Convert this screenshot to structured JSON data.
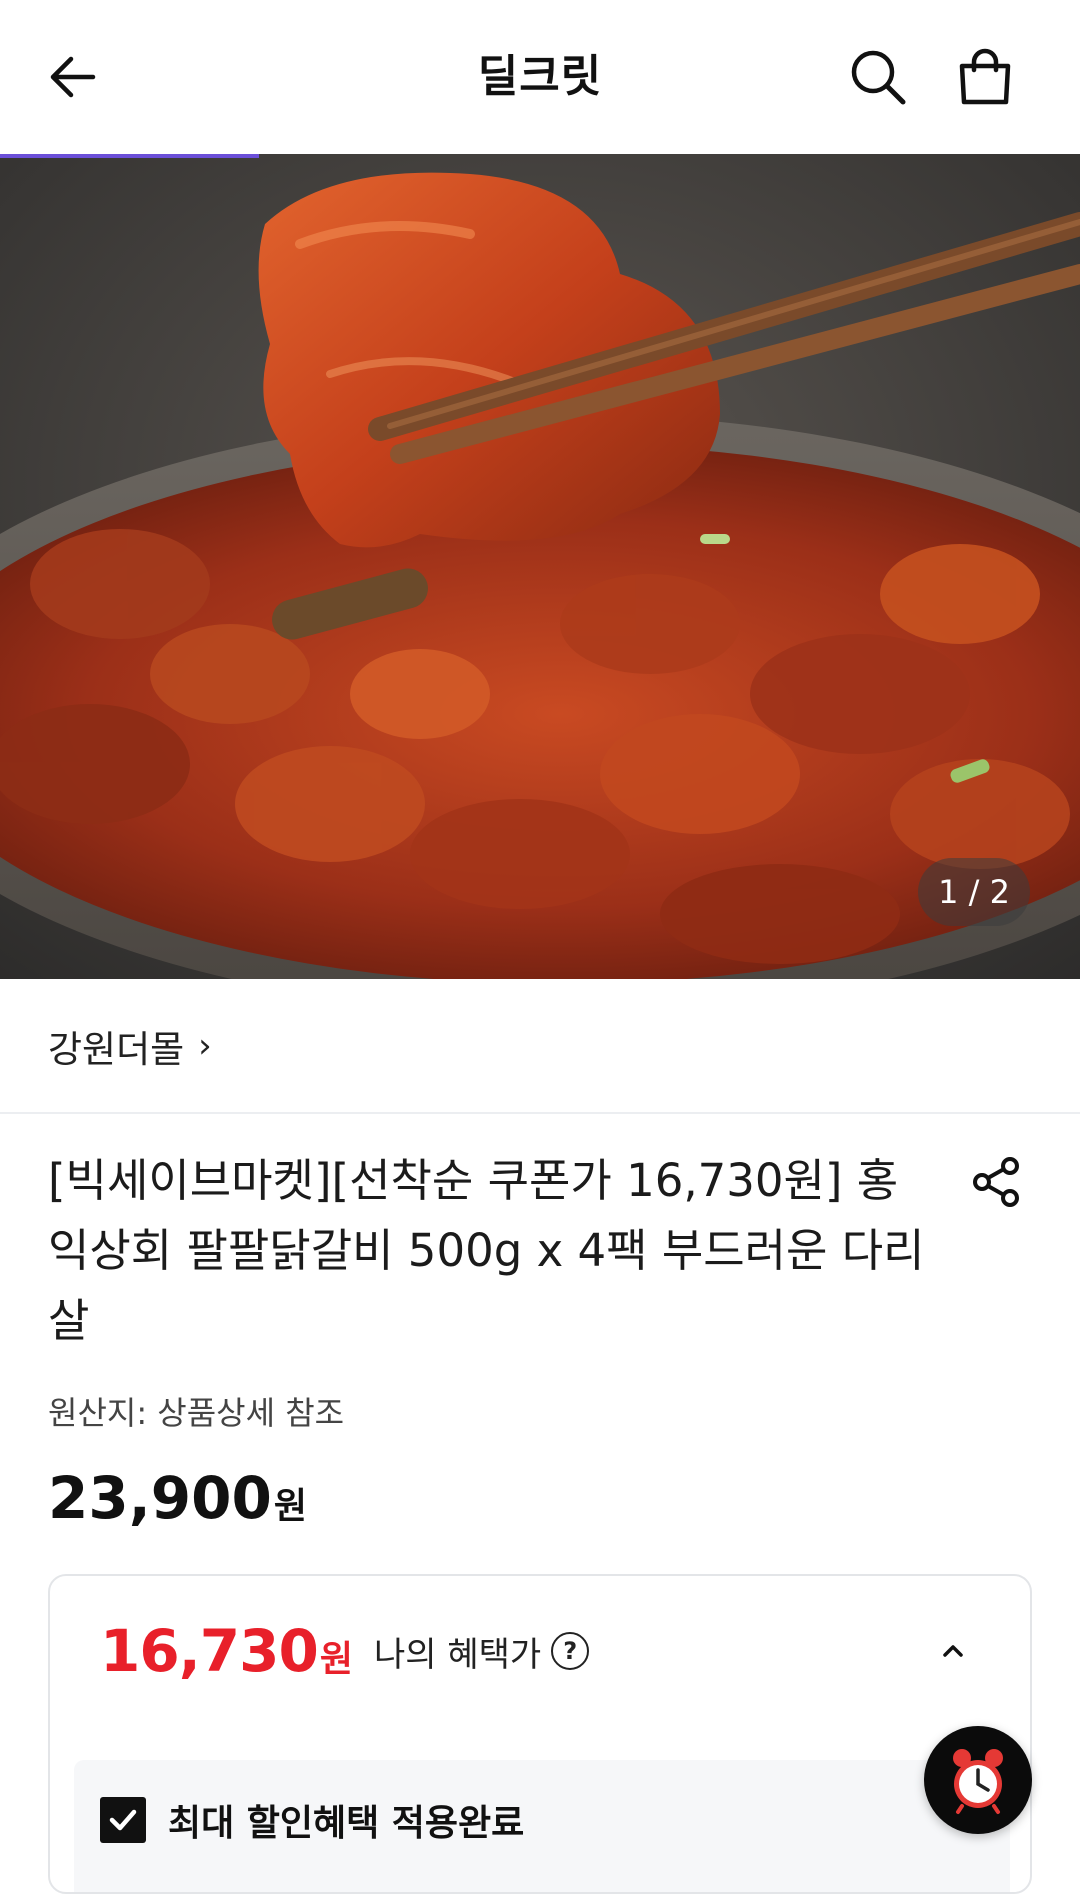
{
  "header": {
    "title": "딜크릿",
    "back_icon": "arrow-left-icon",
    "search_icon": "search-icon",
    "cart_icon": "shopping-bag-icon"
  },
  "gallery": {
    "counter": "1 / 2",
    "progress": 0.24
  },
  "seller": {
    "name": "강원더몰",
    "chevron": "›"
  },
  "product": {
    "title": "[빅세이브마켓][선착순 쿠폰가 16,730원] 홍익상회 팔팔닭갈비 500g x 4팩 부드러운 다리살",
    "origin": "원산지: 상품상세 참조",
    "price": "23,900",
    "price_unit": "원"
  },
  "benefit": {
    "price": "16,730",
    "price_unit": "원",
    "label": "나의 혜택가",
    "help": "?",
    "check_label": "최대 할인혜택 적용완료",
    "accent_color": "#e8202a"
  },
  "floating": {
    "icon": "alarm-clock-icon"
  }
}
